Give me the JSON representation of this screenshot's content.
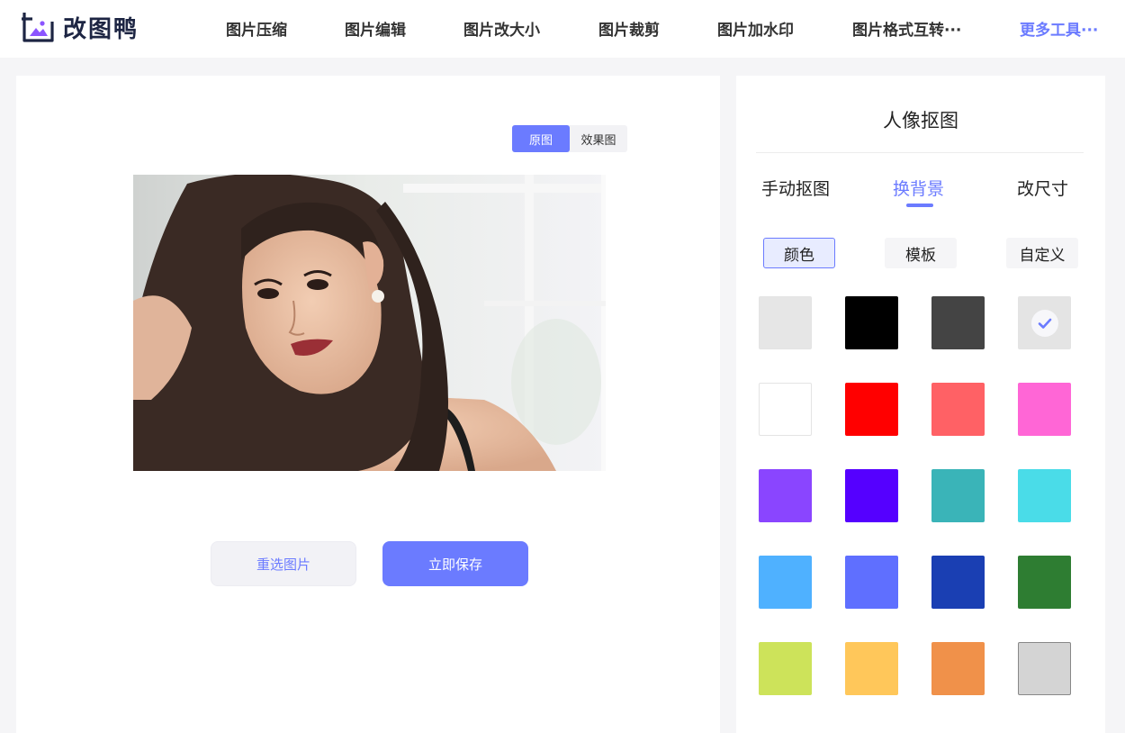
{
  "header": {
    "brand": "改图鸭",
    "nav": [
      {
        "label": "图片压缩"
      },
      {
        "label": "图片编辑"
      },
      {
        "label": "图片改大小"
      },
      {
        "label": "图片裁剪"
      },
      {
        "label": "图片加水印"
      },
      {
        "label": "图片格式互转···"
      },
      {
        "label": "更多工具···"
      }
    ]
  },
  "preview": {
    "toggle": {
      "original": "原图",
      "result": "效果图",
      "selected": "原图"
    },
    "reselect_label": "重选图片",
    "save_label": "立即保存"
  },
  "panel": {
    "title": "人像抠图",
    "tabs": [
      {
        "label": "手动抠图"
      },
      {
        "label": "换背景"
      },
      {
        "label": "改尺寸"
      }
    ],
    "active_tab": "换背景",
    "subtabs": [
      {
        "label": "颜色"
      },
      {
        "label": "模板"
      },
      {
        "label": "自定义"
      }
    ],
    "active_subtab": "颜色",
    "swatches": [
      "#e6e6e6",
      "#000000",
      "#444444",
      "#e4e4e4",
      "#ffffff",
      "#ff0000",
      "#ff6165",
      "#ff66d6",
      "#8a45ff",
      "#5500ff",
      "#3ab4b8",
      "#4adce8",
      "#4fb1ff",
      "#5f6fff",
      "#1a3fb3",
      "#2e7d32",
      "#cde35a",
      "#ffc75a",
      "#f0914a",
      "#d4d4d4"
    ],
    "selected_swatch_index": 3,
    "check_icon": "check-icon",
    "accent": "#6b7bff"
  }
}
